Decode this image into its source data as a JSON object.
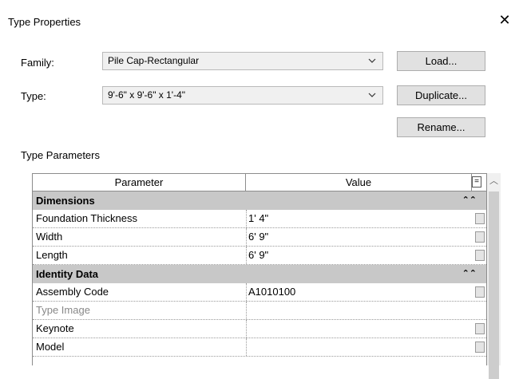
{
  "window": {
    "title": "Type Properties",
    "close_glyph": "✕"
  },
  "family": {
    "label": "Family:",
    "value": "Pile Cap-Rectangular"
  },
  "type": {
    "label": "Type:",
    "value": "9'-6\" x 9'-6\" x 1'-4\""
  },
  "buttons": {
    "load": "Load...",
    "duplicate": "Duplicate...",
    "rename": "Rename..."
  },
  "type_parameters": {
    "title": "Type Parameters",
    "col_parameter": "Parameter",
    "col_value": "Value",
    "col_eq": "="
  },
  "groups": {
    "dimensions": "Dimensions",
    "identity": "Identity Data"
  },
  "rows": {
    "foundation_thickness": {
      "param": "Foundation Thickness",
      "value": "1'  4\""
    },
    "width": {
      "param": "Width",
      "value": "6'  9\""
    },
    "length": {
      "param": "Length",
      "value": "6'  9\""
    },
    "assembly_code": {
      "param": "Assembly Code",
      "value": "A1010100"
    },
    "type_image": {
      "param": "Type Image",
      "value": ""
    },
    "keynote": {
      "param": "Keynote",
      "value": ""
    },
    "model": {
      "param": "Model",
      "value": ""
    }
  },
  "icons": {
    "close": "close-icon",
    "dropdown": "chevron-down-icon",
    "collapse": "double-chevron-up-icon",
    "scroll_up": "scroll-up-icon"
  },
  "colors": {
    "group_header_bg": "#c8c8c8",
    "button_bg": "#e1e1e1",
    "border": "#8c8c8c"
  }
}
